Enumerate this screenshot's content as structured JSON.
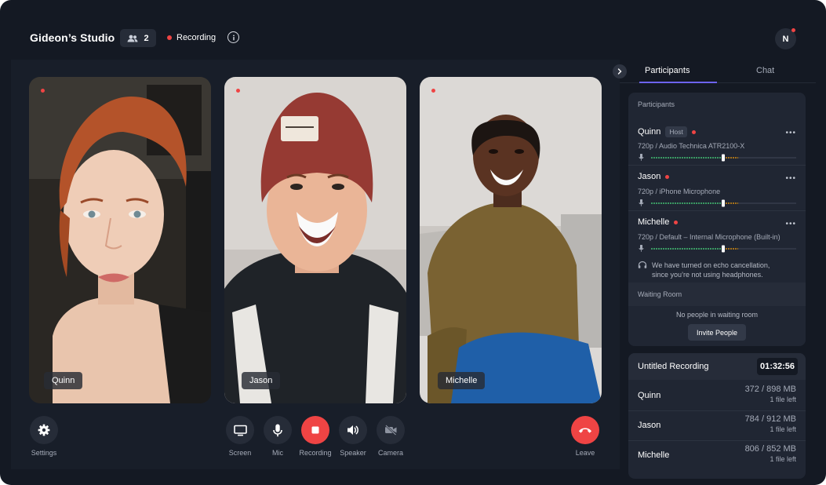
{
  "header": {
    "studio_title": "Gideon’s Studio",
    "participant_count": "2",
    "recording_status": "Recording",
    "avatar_initial": "N"
  },
  "tiles": [
    {
      "name": "Quinn"
    },
    {
      "name": "Jason"
    },
    {
      "name": "Michelle"
    }
  ],
  "controls": {
    "settings": "Settings",
    "screen": "Screen",
    "mic": "Mic",
    "recording": "Recording",
    "speaker": "Speaker",
    "camera": "Camera",
    "leave": "Leave"
  },
  "sidebar": {
    "tabs": [
      "Participants",
      "Chat"
    ],
    "active_tab": "Participants",
    "participants_heading": "Participants",
    "host_badge": "Host",
    "participants": [
      {
        "name": "Quinn",
        "device": "720p / Audio Technica ATR2100-X",
        "volume": 0.45
      },
      {
        "name": "Jason",
        "device": "720p / iPhone Microphone",
        "volume": 0.45
      },
      {
        "name": "Michelle",
        "device": "720p / Default – Internal Microphone (Built-in)",
        "volume": 0.45
      }
    ],
    "echo_notice_line1": "We have turned on echo cancellation,",
    "echo_notice_line2": "since you’re not using headphones.",
    "waiting_room_heading": "Waiting Room",
    "waiting_room_empty": "No people in waiting room",
    "invite_button": "Invite People",
    "recording_card": {
      "title": "Untitled Recording",
      "timer": "01:32:56",
      "files": [
        {
          "name": "Quinn",
          "size": "372 / 898 MB",
          "files_left": "1 file left"
        },
        {
          "name": "Jason",
          "size": "784 / 912 MB",
          "files_left": "1 file left"
        },
        {
          "name": "Michelle",
          "size": "806 / 852 MB",
          "files_left": "1 file left"
        }
      ]
    }
  },
  "colors": {
    "background": "#141923",
    "panel": "#202633",
    "accent": "#6d63f0",
    "recording_red": "#ef4444",
    "meter_green": "#4ade80",
    "meter_orange": "#f59e0b"
  }
}
